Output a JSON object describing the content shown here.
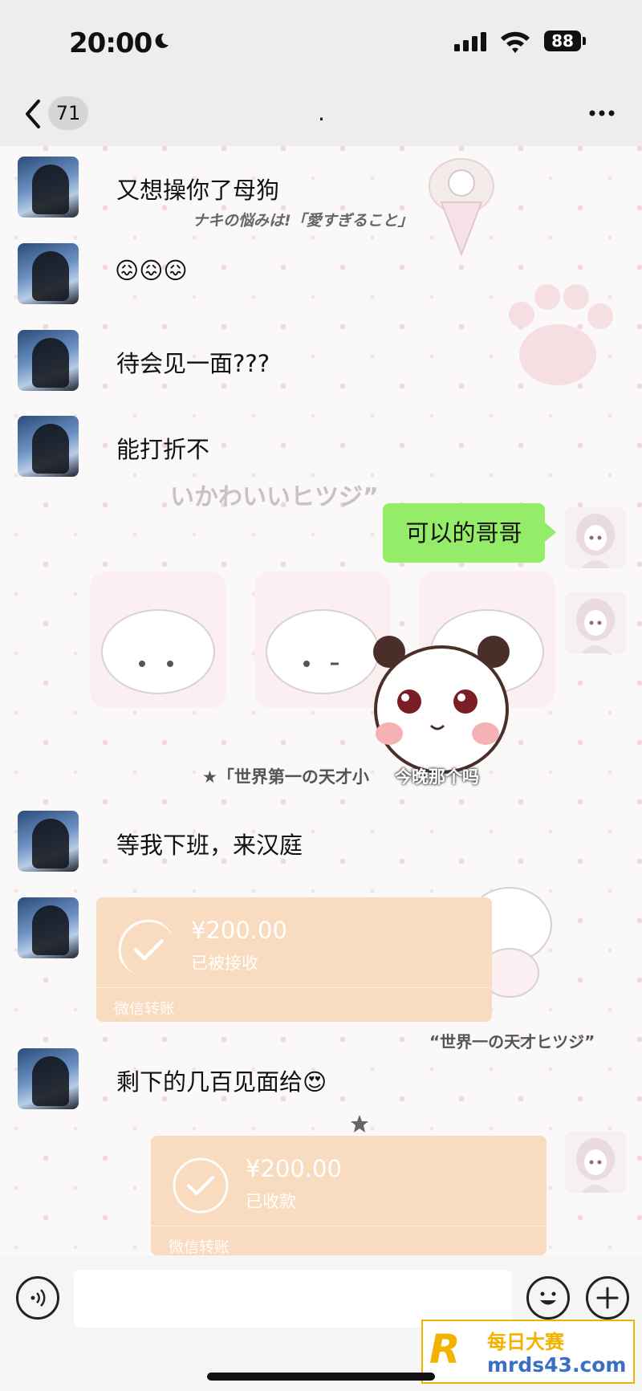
{
  "status_bar": {
    "time": "20:00",
    "battery": "88"
  },
  "nav": {
    "back_count": "71",
    "title": "."
  },
  "messages": [
    {
      "side": "left",
      "text": "又想操你了母狗"
    },
    {
      "side": "left",
      "text": "😖😖😖"
    },
    {
      "side": "left",
      "text": "待会见一面???"
    },
    {
      "side": "left",
      "text": "能打折不"
    },
    {
      "side": "right",
      "text": "可以的哥哥"
    },
    {
      "side": "left",
      "text": "等我下班，来汉庭"
    },
    {
      "side": "left",
      "type": "transfer",
      "amount": "¥200.00",
      "status": "已被接收",
      "footer": "微信转账"
    },
    {
      "side": "left",
      "text": "剩下的几百见面给😍"
    },
    {
      "side": "right",
      "type": "transfer",
      "amount": "¥200.00",
      "status": "已收款",
      "footer": "微信转账"
    }
  ],
  "background_decor": {
    "text1": "ナキの悩みは!「愛すぎること」",
    "text2": "いかわいいヒツジ”",
    "text3": "★「世界第一の天才小",
    "sticker_caption": "今晚那个吗",
    "text4": "“世界一の天才ヒツジ”"
  },
  "watermark": {
    "line1": "每日大赛",
    "line2": "mrds43.com"
  }
}
